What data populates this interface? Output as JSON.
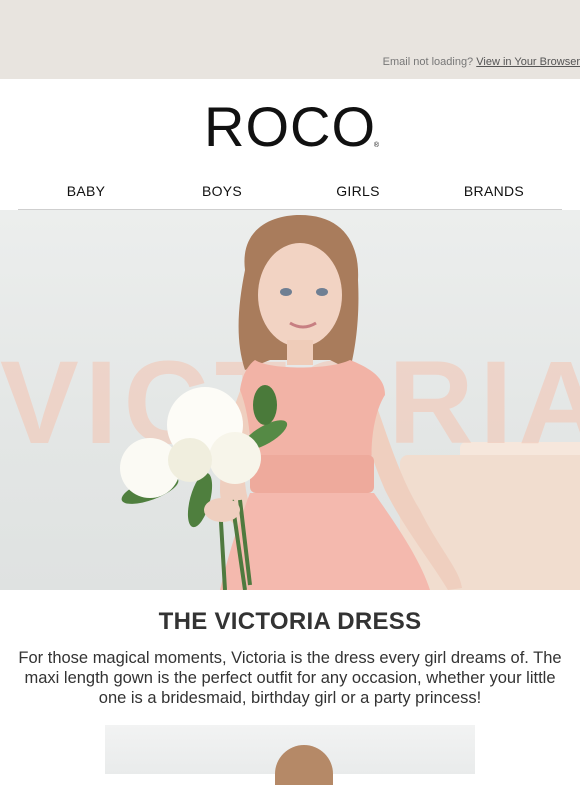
{
  "preheader": {
    "text": "Email not loading?",
    "link": "View in Your Browser"
  },
  "brand": {
    "name": "ROCO",
    "reg": "®"
  },
  "nav": {
    "items": [
      "BABY",
      "BOYS",
      "GIRLS",
      "BRANDS"
    ]
  },
  "hero": {
    "watermark": "VICTORIA"
  },
  "feature": {
    "title": "THE VICTORIA DRESS",
    "body": "For those magical moments, Victoria is the dress every girl dreams of. The maxi length gown is the perfect outfit for any occasion, whether your little one is a bridesmaid, birthday girl or a party princess!"
  },
  "colors": {
    "preheader_bg": "#e8e4df",
    "watermark": "#f0cdbf",
    "dress": "#f4b9ae"
  }
}
